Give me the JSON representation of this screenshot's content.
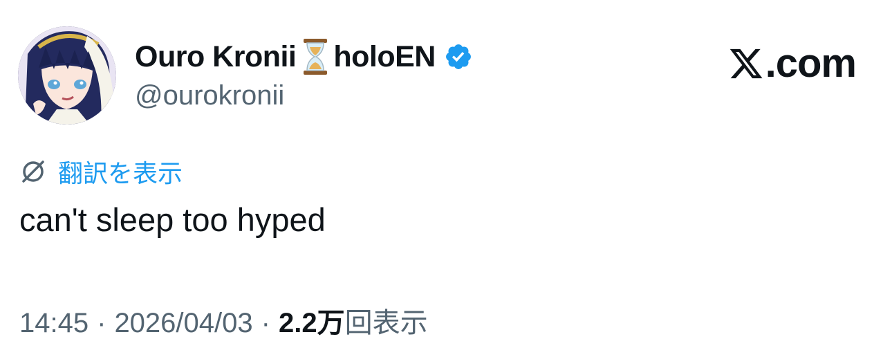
{
  "author": {
    "display_name": "Ouro Kronii",
    "display_name_suffix": "holoEN",
    "handle": "@ourokronii",
    "badge_color": "#1d9bf0"
  },
  "brand": {
    "text": ".com"
  },
  "translate": {
    "label": "翻訳を表示"
  },
  "tweet": {
    "text": "can't sleep too hyped"
  },
  "meta": {
    "time": "14:45",
    "separator": "·",
    "date": "2026/04/03",
    "views_count": "2.2",
    "views_unit": "万",
    "views_label": "回表示"
  },
  "icons": [
    "avatar",
    "hourglass-icon",
    "verified-badge-icon",
    "x-logo-icon",
    "translate-globe-icon"
  ]
}
